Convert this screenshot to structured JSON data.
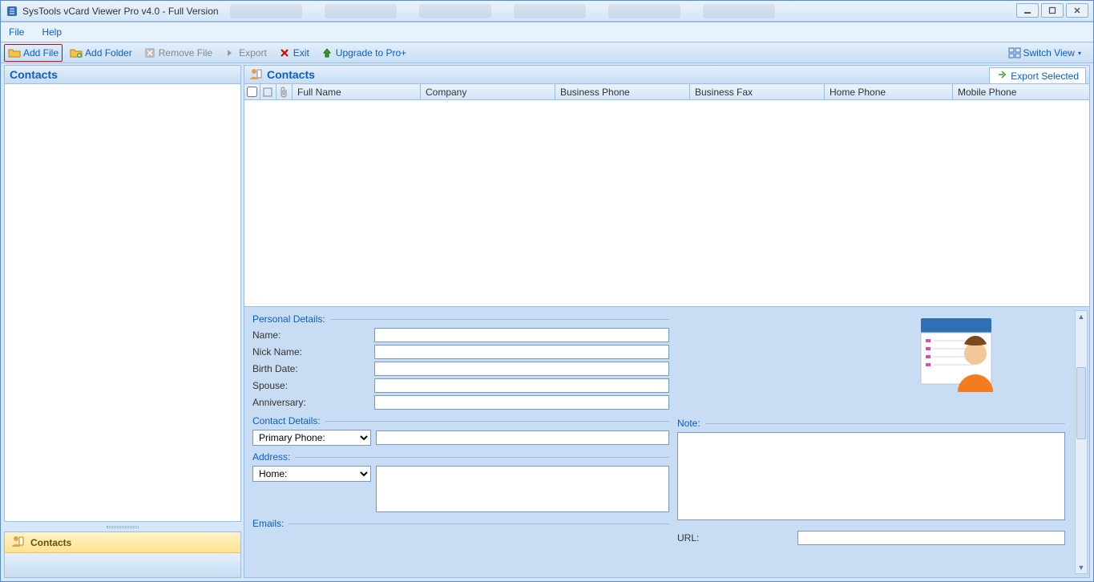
{
  "window": {
    "title": "SysTools vCard Viewer Pro v4.0 - Full Version"
  },
  "menubar": {
    "file": "File",
    "help": "Help"
  },
  "toolbar": {
    "add_file": "Add File",
    "add_folder": "Add Folder",
    "remove_file": "Remove File",
    "export": "Export",
    "exit": "Exit",
    "upgrade": "Upgrade to Pro+",
    "switch_view": "Switch View"
  },
  "left_panel": {
    "title": "Contacts",
    "footer": "Contacts"
  },
  "grid": {
    "title": "Contacts",
    "export_selected": "Export Selected",
    "cols": {
      "full_name": "Full Name",
      "company": "Company",
      "business_phone": "Business Phone",
      "business_fax": "Business Fax",
      "home_phone": "Home Phone",
      "mobile_phone": "Mobile Phone"
    }
  },
  "details": {
    "personal_legend": "Personal Details:",
    "name": "Name:",
    "nick_name": "Nick Name:",
    "birth_date": "Birth Date:",
    "spouse": "Spouse:",
    "anniversary": "Anniversary:",
    "contact_legend": "Contact Details:",
    "primary_phone": "Primary Phone:",
    "address_legend": "Address:",
    "address_home": "Home:",
    "emails_legend": "Emails:",
    "note_legend": "Note:",
    "url_label": "URL:"
  },
  "values": {
    "name": "",
    "nick_name": "",
    "birth_date": "",
    "spouse": "",
    "anniversary": "",
    "primary_phone": "",
    "address": "",
    "note": "",
    "url": ""
  }
}
